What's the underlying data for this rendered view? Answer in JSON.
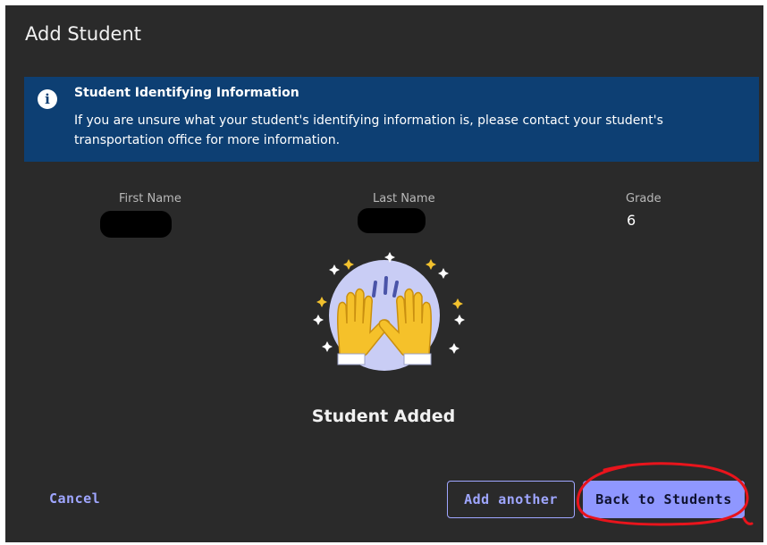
{
  "dialog": {
    "title": "Add Student"
  },
  "info_banner": {
    "icon": "info-icon",
    "icon_glyph": "i",
    "title": "Student Identifying Information",
    "text": "If you are unsure what your student's identifying information is, please contact your student's transportation office for more information."
  },
  "student": {
    "first_name_label": "First Name",
    "first_name_value": "",
    "last_name_label": "Last Name",
    "last_name_value": "",
    "grade_label": "Grade",
    "grade_value": "6"
  },
  "status": {
    "illustration_icon": "raised-hands-celebration-icon",
    "message": "Student Added"
  },
  "actions": {
    "cancel_label": "Cancel",
    "add_another_label": "Add another",
    "back_label": "Back to Students"
  },
  "colors": {
    "dialog_bg": "#2a2a2a",
    "banner_bg": "#0d3f73",
    "accent": "#8f97ff",
    "annotation": "#e8141c"
  }
}
